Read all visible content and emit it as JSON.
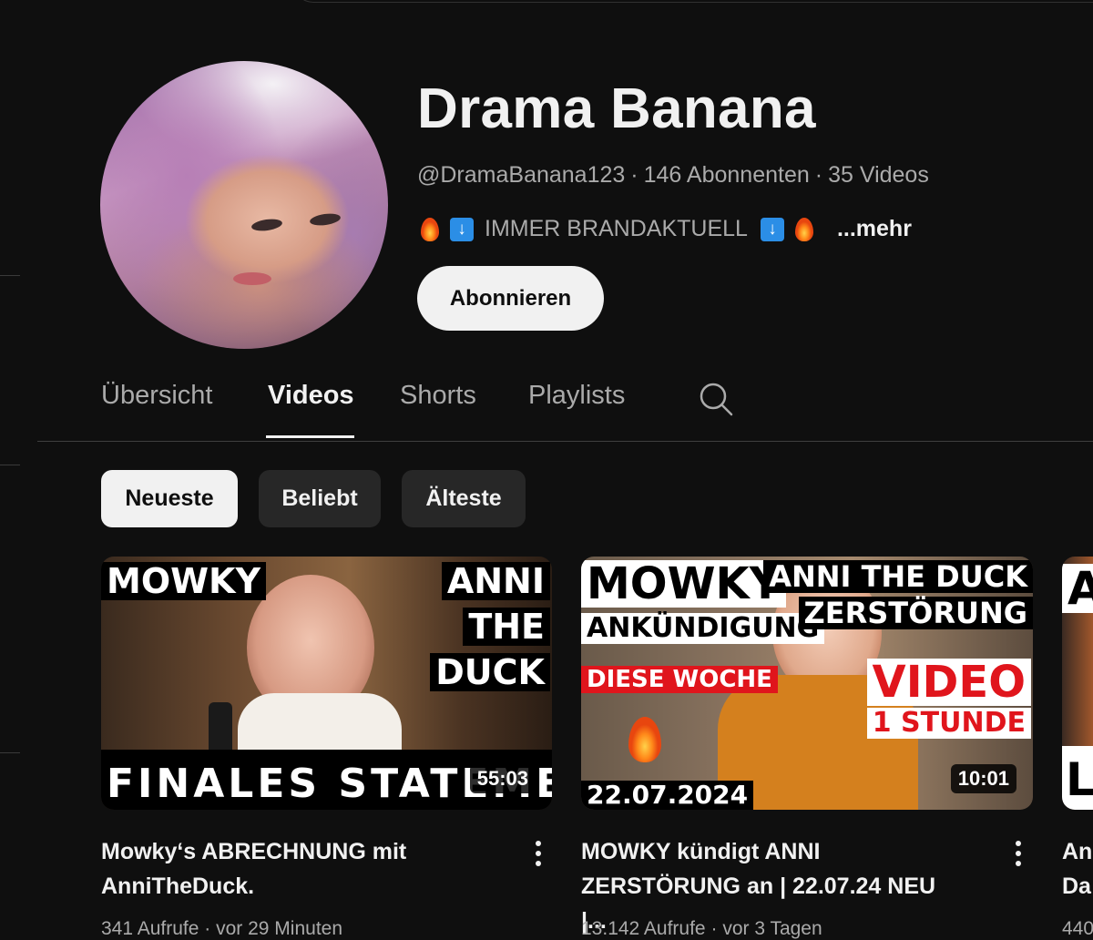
{
  "channel": {
    "name": "Drama Banana",
    "handle": "@DramaBanana123",
    "subscribers": "146 Abonnenten",
    "video_count": "35 Videos",
    "separator": "·",
    "description": "IMMER BRANDAKTUELL",
    "more_label": "...mehr",
    "subscribe_label": "Abonnieren"
  },
  "tabs": [
    {
      "label": "Übersicht",
      "active": false
    },
    {
      "label": "Videos",
      "active": true
    },
    {
      "label": "Shorts",
      "active": false
    },
    {
      "label": "Playlists",
      "active": false
    }
  ],
  "chips": [
    {
      "label": "Neueste",
      "active": true
    },
    {
      "label": "Beliebt",
      "active": false
    },
    {
      "label": "Älteste",
      "active": false
    }
  ],
  "videos": [
    {
      "title": "Mowky‘s ABRECHNUNG mit AnniTheDuck.",
      "views": "341 Aufrufe",
      "age": "vor 29 Minuten",
      "duration": "55:03",
      "thumb_text": {
        "top_left": "MOWKY",
        "right": [
          "ANNI",
          "THE",
          "DUCK"
        ],
        "bottom": "FINALES STATEMENT"
      }
    },
    {
      "title": "MOWKY kündigt ANNI ZERSTÖRUNG an | 22.07.24 NEU |...",
      "views": "13.142 Aufrufe",
      "age": "vor 3 Tagen",
      "duration": "10:01",
      "thumb_text": {
        "top_left": "MOWKY",
        "sub_left": "ANKÜNDIGUNG",
        "red": "DIESE WOCHE",
        "date": "22.07.2024",
        "right": [
          "ANNI THE DUCK",
          "ZERSTÖRUNG"
        ],
        "video": [
          "VIDEO",
          "1 STUNDE"
        ]
      }
    },
    {
      "title": "An Da",
      "views": "440",
      "thumb_text": {
        "top": "A",
        "bottom": "L"
      }
    }
  ],
  "colors": {
    "background": "#0f0f0f",
    "text": "#f1f1f1",
    "muted": "#aaaaaa",
    "chip": "#272727",
    "badge_red": "#e0151c"
  }
}
